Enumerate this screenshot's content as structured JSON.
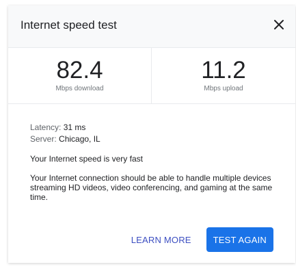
{
  "dialog": {
    "title": "Internet speed test",
    "close_icon": "close-icon"
  },
  "results": {
    "download_value": "82.4",
    "download_unit": "Mbps download",
    "upload_value": "11.2",
    "upload_unit": "Mbps upload"
  },
  "details": {
    "latency_label": "Latency:",
    "latency_value": "31 ms",
    "server_label": "Server:",
    "server_value": "Chicago, IL",
    "speed_summary": "Your Internet speed is very fast",
    "speed_description": "Your Internet connection should be able to handle multiple devices streaming HD videos, video conferencing, and gaming at the same time."
  },
  "actions": {
    "learn_more_label": "LEARN MORE",
    "test_again_label": "TEST AGAIN"
  },
  "colors": {
    "primary_button": "#1a73e8",
    "link": "#3c4ec1",
    "header_bg": "#f8f9fa"
  }
}
